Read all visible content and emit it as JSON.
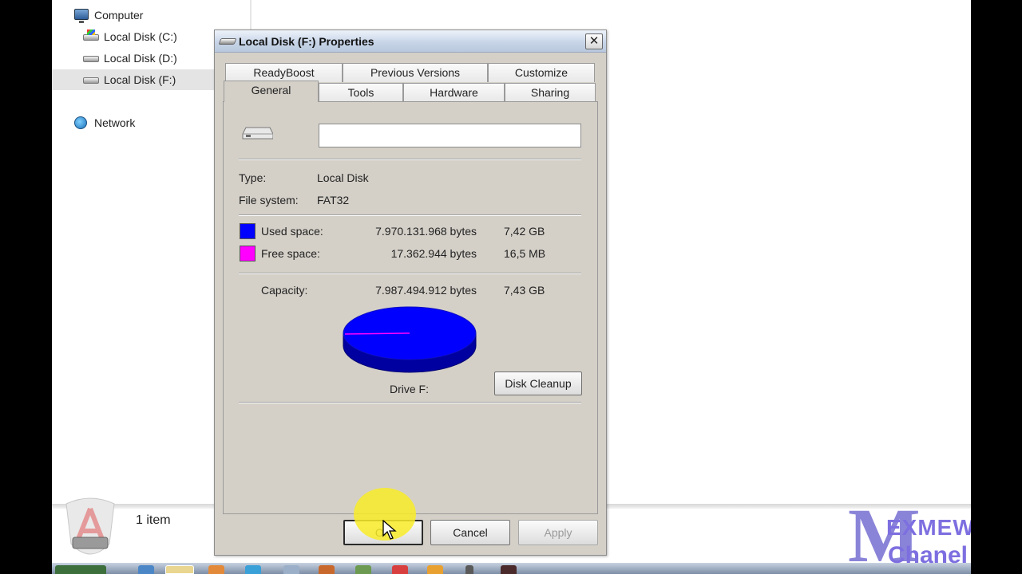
{
  "nav": {
    "items": [
      {
        "label": "Computer"
      },
      {
        "label": "Local Disk (C:)"
      },
      {
        "label": "Local Disk (D:)"
      },
      {
        "label": "Local Disk (F:)"
      },
      {
        "label": "Network"
      }
    ]
  },
  "status": {
    "item_count": "1 item"
  },
  "logo": {
    "line1": "EXMEW",
    "line2": "Chanel",
    "big_letter": "M"
  },
  "dialog": {
    "title": "Local Disk (F:) Properties",
    "close_label": "✕",
    "tabs_row1": [
      "ReadyBoost",
      "Previous Versions",
      "Customize"
    ],
    "tabs_row2": [
      "General",
      "Tools",
      "Hardware",
      "Sharing"
    ],
    "active_tab": "General",
    "drive_name_value": "",
    "type_label": "Type:",
    "type_value": "Local Disk",
    "fs_label": "File system:",
    "fs_value": "FAT32",
    "used_label": "Used space:",
    "used_bytes": "7.970.131.968 bytes",
    "used_size": "7,42 GB",
    "free_label": "Free space:",
    "free_bytes": "17.362.944 bytes",
    "free_size": "16,5 MB",
    "capacity_label": "Capacity:",
    "capacity_bytes": "7.987.494.912 bytes",
    "capacity_size": "7,43 GB",
    "drive_caption": "Drive F:",
    "cleanup_label": "Disk Cleanup",
    "ok_label": "OK",
    "cancel_label": "Cancel",
    "apply_label": "Apply",
    "used_fraction": 0.9978,
    "colors": {
      "used": "#0000ff",
      "free": "#ff00ff"
    }
  }
}
